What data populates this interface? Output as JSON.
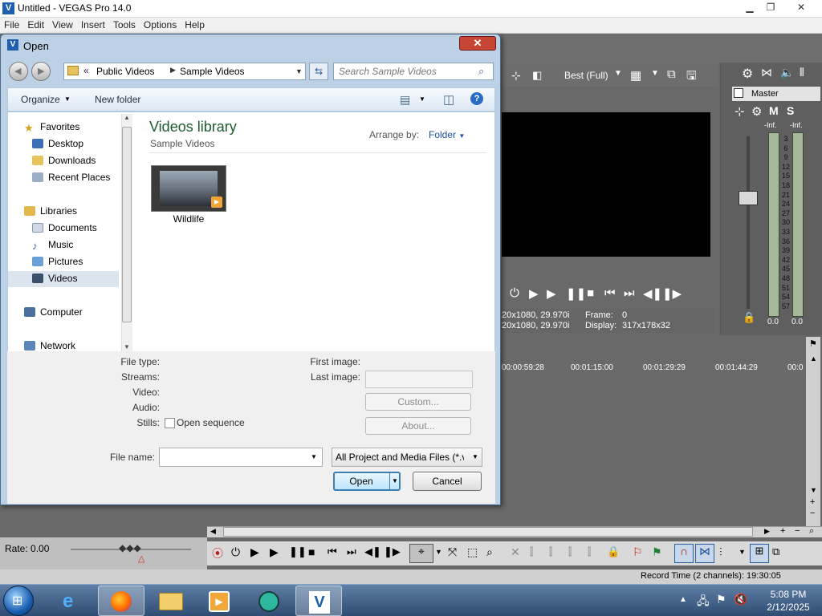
{
  "app": {
    "title": "Untitled - VEGAS Pro 14.0",
    "logo": "V",
    "menu": [
      "File",
      "Edit",
      "View",
      "Insert",
      "Tools",
      "Options",
      "Help"
    ]
  },
  "preview": {
    "quality": "Best (Full)",
    "info_line1": "20x1080, 29.970i",
    "info_line2": "20x1080, 29.970i",
    "frame_label": "Frame:",
    "frame_value": "0",
    "display_label": "Display:",
    "display_value": "317x178x32"
  },
  "master": {
    "title": "Master",
    "mute": "M",
    "solo": "S",
    "peak_left": "-Inf.",
    "peak_right": "-Inf.",
    "scale": [
      "3",
      "6",
      "9",
      "12",
      "15",
      "18",
      "21",
      "24",
      "27",
      "30",
      "33",
      "36",
      "39",
      "42",
      "45",
      "48",
      "51",
      "54",
      "57"
    ],
    "level_left": "0.0",
    "level_right": "0.0"
  },
  "timeline": {
    "ruler": [
      "00:00:59:28",
      "00:01:15:00",
      "00:01:29:29",
      "00:01:44:29",
      "00:0"
    ]
  },
  "status": {
    "rate": "Rate: 0.00",
    "record_time": "Record Time (2 channels): 19:30:05"
  },
  "dialog": {
    "title": "Open",
    "close": "✕",
    "breadcrumb": [
      "Public Videos",
      "Sample Videos"
    ],
    "search_placeholder": "Search Sample Videos",
    "organize": "Organize",
    "new_folder": "New folder",
    "nav": {
      "favorites": "Favorites",
      "desktop": "Desktop",
      "downloads": "Downloads",
      "recent": "Recent Places",
      "libraries": "Libraries",
      "documents": "Documents",
      "music": "Music",
      "pictures": "Pictures",
      "videos": "Videos",
      "computer": "Computer",
      "network": "Network"
    },
    "library_title": "Videos library",
    "library_sub": "Sample Videos",
    "arrange_by": "Arrange by:",
    "arrange_value": "Folder",
    "file_item": "Wildlife",
    "details": {
      "file_type": "File type:",
      "streams": "Streams:",
      "video": "Video:",
      "audio": "Audio:",
      "stills": "Stills:",
      "open_sequence": "Open sequence",
      "first_image": "First image:",
      "last_image": "Last image:",
      "custom": "Custom...",
      "about": "About..."
    },
    "file_name_label": "File name:",
    "file_name_value": "",
    "file_type_filter": "All Project and Media Files (*.ve",
    "open_button": "Open",
    "cancel_button": "Cancel"
  },
  "taskbar": {
    "time": "5:08 PM",
    "date": "2/12/2025"
  }
}
